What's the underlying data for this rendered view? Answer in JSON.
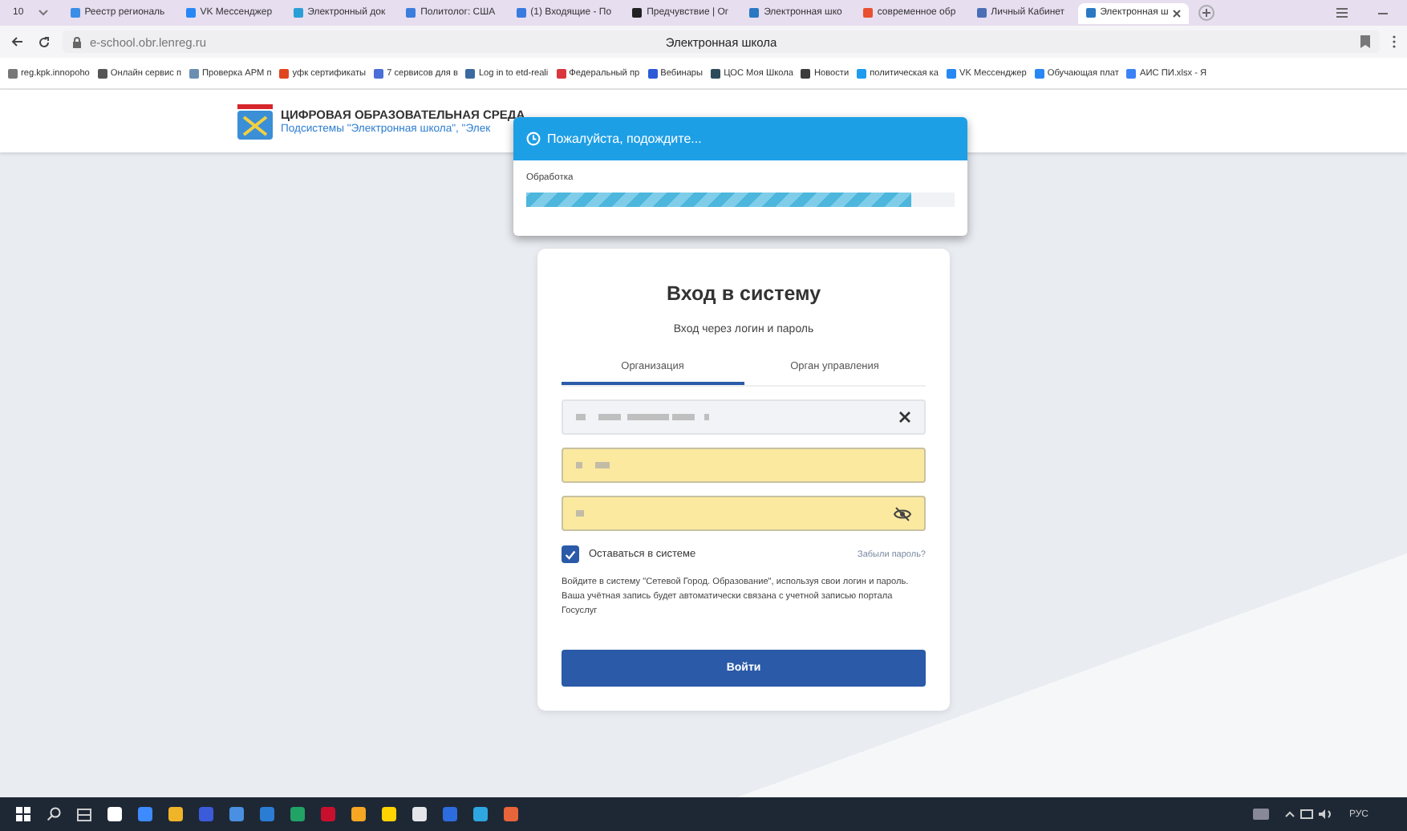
{
  "browser": {
    "tab_count": "10",
    "tabs": [
      {
        "label": "Реестр региональ",
        "selected": false,
        "color": "#3a8ee6"
      },
      {
        "label": "VK Мессенджер",
        "selected": false,
        "color": "#2787f5"
      },
      {
        "label": "Электронный док",
        "selected": false,
        "color": "#2a9fd6"
      },
      {
        "label": "Политолог: США",
        "selected": false,
        "color": "#3b7ddd"
      },
      {
        "label": "(1) Входящие - По",
        "selected": false,
        "color": "#3a7be0"
      },
      {
        "label": "Предчувствие | Ог",
        "selected": false,
        "color": "#222222"
      },
      {
        "label": "Электронная шко",
        "selected": false,
        "color": "#2b78c2"
      },
      {
        "label": "современное обр",
        "selected": false,
        "color": "#e8502f"
      },
      {
        "label": "Личный Кабинет",
        "selected": false,
        "color": "#4a6fb5"
      },
      {
        "label": "Электронная ш",
        "selected": true,
        "color": "#2b78c2"
      }
    ],
    "url": "e-school.obr.lenreg.ru",
    "page_title": "Электронная школа",
    "bookmarks": [
      {
        "label": "reg.kpk.innopoho",
        "color": "#777777"
      },
      {
        "label": "Онлайн сервис п",
        "color": "#555555"
      },
      {
        "label": "Проверка АРМ п",
        "color": "#6a8fb0"
      },
      {
        "label": "уфк сертификаты",
        "color": "#e0461e"
      },
      {
        "label": "7 сервисов для в",
        "color": "#4b6fd8"
      },
      {
        "label": "Log in to etd-reali",
        "color": "#3b6aa0"
      },
      {
        "label": "Федеральный пр",
        "color": "#d9363e"
      },
      {
        "label": "Вебинары",
        "color": "#2b5bd7"
      },
      {
        "label": "ЦОС Моя Школа",
        "color": "#2c4a5a"
      },
      {
        "label": "Новости",
        "color": "#3b3b3b"
      },
      {
        "label": "политическая ка",
        "color": "#1d9bf0"
      },
      {
        "label": "VK Мессенджер",
        "color": "#2787f5"
      },
      {
        "label": "Обучающая плат",
        "color": "#2787f5"
      },
      {
        "label": "АИС ПИ.xlsx - Я",
        "color": "#3b82f6"
      }
    ]
  },
  "header": {
    "title": "ЦИФРОВАЯ ОБРАЗОВАТЕЛЬНАЯ СРЕДА",
    "subtitle": "Подсистемы \"Электронная школа\", \"Элек"
  },
  "wait_dialog": {
    "title": "Пожалуйста, подождите...",
    "label": "Обработка",
    "level": 0.9
  },
  "login": {
    "title": "Вход в систему",
    "subtitle": "Вход через логин и пароль",
    "tabs": [
      {
        "label": "Организация",
        "selected": true
      },
      {
        "label": "Орган управления",
        "selected": false
      }
    ],
    "fields": [
      {
        "kind": "select",
        "autofilled": false
      },
      {
        "kind": "login",
        "autofilled": true
      },
      {
        "kind": "password",
        "autofilled": true
      }
    ],
    "remember": {
      "label": "Оставаться в системе",
      "checked": true
    },
    "forgot": "Забыли пароль?",
    "note": "Войдите в систему \"Сетевой Город. Образование\", используя свои логин и пароль. Ваша учётная запись будет автоматически связана с учетной записью портала Госуслуг",
    "submit": "Войти"
  },
  "tray": {
    "language": "РУС"
  }
}
